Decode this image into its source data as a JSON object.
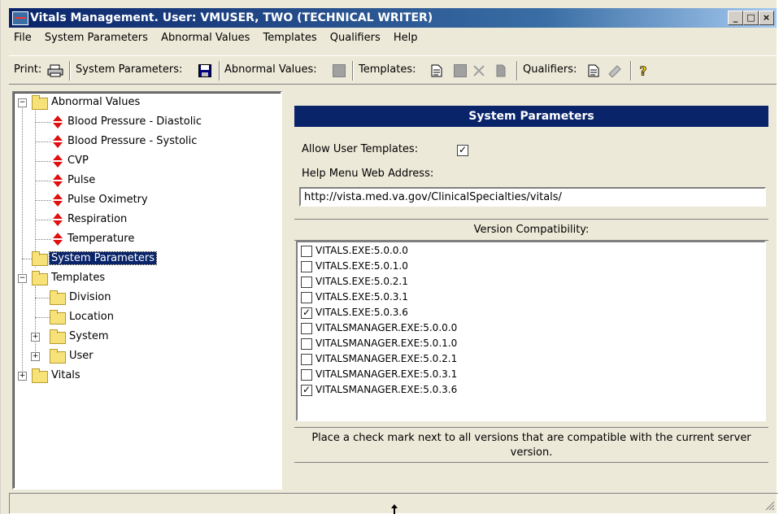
{
  "window": {
    "title_prefix": "Vitals Management. User:",
    "title_user": "VMUSER, TWO (TECHNICAL WRITER)",
    "minimize": "_",
    "maximize": "□",
    "close": "×"
  },
  "menu": [
    "File",
    "System Parameters",
    "Abnormal Values",
    "Templates",
    "Qualifiers",
    "Help"
  ],
  "toolbar": {
    "print_label": "Print:",
    "sysparams_label": "System Parameters:",
    "abnormal_label": "Abnormal Values:",
    "templates_label": "Templates:",
    "qualifiers_label": "Qualifiers:"
  },
  "tree": {
    "abnormal_values": "Abnormal Values",
    "abnormal_children": [
      "Blood Pressure - Diastolic",
      "Blood Pressure - Systolic",
      "CVP",
      "Pulse",
      "Pulse Oximetry",
      "Respiration",
      "Temperature"
    ],
    "system_parameters": "System Parameters",
    "templates": "Templates",
    "template_children": [
      "Division",
      "Location",
      "System",
      "User"
    ],
    "vitals": "Vitals"
  },
  "panel": {
    "header": "System Parameters",
    "allow_user_templates_label": "Allow User Templates:",
    "allow_user_templates_checked": true,
    "help_menu_label": "Help Menu Web Address:",
    "help_url": "http://vista.med.va.gov/ClinicalSpecialties/vitals/",
    "version_header": "Version Compatibility:",
    "versions": [
      {
        "name": "VITALS.EXE:5.0.0.0",
        "checked": false
      },
      {
        "name": "VITALS.EXE:5.0.1.0",
        "checked": false
      },
      {
        "name": "VITALS.EXE:5.0.2.1",
        "checked": false
      },
      {
        "name": "VITALS.EXE:5.0.3.1",
        "checked": false
      },
      {
        "name": "VITALS.EXE:5.0.3.6",
        "checked": true
      },
      {
        "name": "VITALSMANAGER.EXE:5.0.0.0",
        "checked": false
      },
      {
        "name": "VITALSMANAGER.EXE:5.0.1.0",
        "checked": false
      },
      {
        "name": "VITALSMANAGER.EXE:5.0.2.1",
        "checked": false
      },
      {
        "name": "VITALSMANAGER.EXE:5.0.3.1",
        "checked": false
      },
      {
        "name": "VITALSMANAGER.EXE:5.0.3.6",
        "checked": true
      }
    ],
    "note": "Place a check mark next to all versions that are compatible with the current server version."
  },
  "colors": {
    "title_bar": "#0a246a",
    "panel_header": "#0a246a",
    "selection": "#0a246a",
    "arrow_red": "#e01010"
  }
}
